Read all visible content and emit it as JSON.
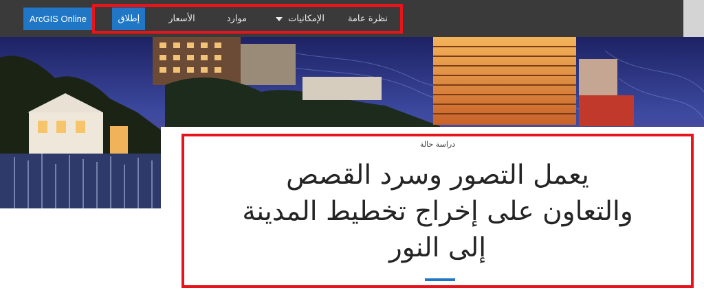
{
  "nav": {
    "arcgis_button": "ArcGIS Online",
    "items": [
      {
        "label": "نظرة عامة"
      },
      {
        "label": "الإمكانيات"
      },
      {
        "label": "موارد"
      },
      {
        "label": "الأسعار"
      },
      {
        "label": "إطلاق"
      }
    ]
  },
  "hero": {
    "image": "city skyline at dusk with lit high-rise towers and a white two-story house"
  },
  "article": {
    "eyebrow": "دراسة حالة",
    "headline_lines": [
      "يعمل التصور وسرد القصص",
      "والتعاون على إخراج تخطيط المدينة",
      "إلى النور"
    ]
  },
  "colors": {
    "nav_bg": "#3a3a3a",
    "accent_blue": "#1f77c5",
    "highlight_red": "#e8141c"
  }
}
